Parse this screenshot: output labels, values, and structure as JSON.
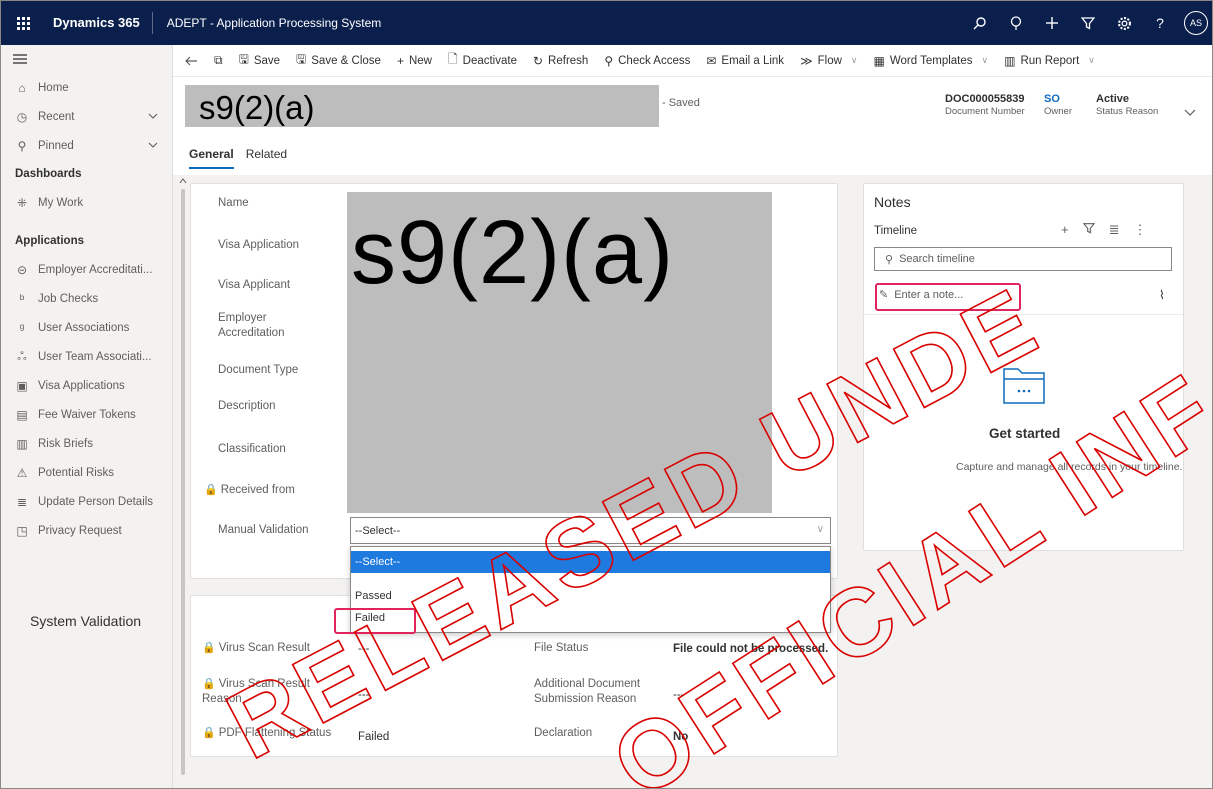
{
  "topbar": {
    "brand": "Dynamics 365",
    "app_name": "ADEPT - Application Processing System",
    "avatar_initials": "AS",
    "icons": [
      "search-icon",
      "lightbulb-icon",
      "plus-icon",
      "filter-icon",
      "settings-icon",
      "help-icon"
    ]
  },
  "sidebar": {
    "items_top": [
      {
        "label": "Home",
        "icon": "home-icon"
      },
      {
        "label": "Recent",
        "icon": "clock-icon"
      },
      {
        "label": "Pinned",
        "icon": "pin-icon"
      }
    ],
    "dashboards_heading": "Dashboards",
    "dashboards": [
      {
        "label": "My Work",
        "icon": "dashboard-icon"
      }
    ],
    "applications_heading": "Applications",
    "applications": [
      {
        "label": "Employer Accreditati...",
        "icon": "accreditation-icon"
      },
      {
        "label": "Job Checks",
        "icon": "job-check-icon"
      },
      {
        "label": "User Associations",
        "icon": "user-association-icon"
      },
      {
        "label": "User Team Associati...",
        "icon": "team-association-icon"
      },
      {
        "label": "Visa Applications",
        "icon": "clipboard-icon"
      },
      {
        "label": "Fee Waiver Tokens",
        "icon": "token-icon"
      },
      {
        "label": "Risk Briefs",
        "icon": "brief-icon"
      },
      {
        "label": "Potential Risks",
        "icon": "risk-icon"
      },
      {
        "label": "Update Person Details",
        "icon": "person-details-icon"
      },
      {
        "label": "Privacy Request",
        "icon": "privacy-icon"
      }
    ]
  },
  "commandbar": {
    "save": "Save",
    "save_close": "Save & Close",
    "new": "New",
    "deactivate": "Deactivate",
    "refresh": "Refresh",
    "check_access": "Check Access",
    "email_link": "Email a Link",
    "flow": "Flow",
    "word_templates": "Word Templates",
    "run_report": "Run Report"
  },
  "header": {
    "title_redacted": "s9(2)(a)",
    "saved_status": "- Saved",
    "document_number_value": "DOC000055839",
    "document_number_label": "Document Number",
    "owner_value": "SO",
    "owner_label": "Owner",
    "status_reason_value": "Active",
    "status_reason_label": "Status Reason"
  },
  "tabs": {
    "general": "General",
    "related": "Related"
  },
  "general": {
    "fields": {
      "name": "Name",
      "visa_application": "Visa Application",
      "visa_applicant": "Visa Applicant",
      "employer_accreditation": "Employer Accreditation",
      "document_type": "Document Type",
      "description": "Description",
      "classification": "Classification",
      "received_from": "Received from",
      "manual_validation": "Manual Validation"
    },
    "redaction_text": "s9(2)(a)",
    "manual_validation_value": "--Select--",
    "manual_validation_options": [
      "--Select--",
      "Passed",
      "Failed"
    ]
  },
  "system_validation": {
    "title": "System Validation",
    "virus_scan_result_label": "Virus Scan Result",
    "virus_scan_result_value": "---",
    "virus_scan_reason_label": "Virus Scan Result Reason",
    "virus_scan_reason_value": "---",
    "pdf_flattening_label": "PDF Flattening Status",
    "pdf_flattening_value": "Failed",
    "file_status_label": "File Status",
    "file_status_value": "File could not be processed.",
    "additional_doc_label": "Additional Document Submission Reason",
    "additional_doc_value": "---",
    "declaration_label": "Declaration",
    "declaration_value": "No"
  },
  "notes": {
    "title": "Notes",
    "timeline_label": "Timeline",
    "search_placeholder": "Search timeline",
    "note_placeholder": "Enter a note...",
    "get_started": "Get started",
    "get_started_sub": "Capture and manage all records in your timeline."
  },
  "watermark": {
    "line1": "RELEASED UNDER THE",
    "line2": "OFFICIAL INFORMATION ACT"
  }
}
